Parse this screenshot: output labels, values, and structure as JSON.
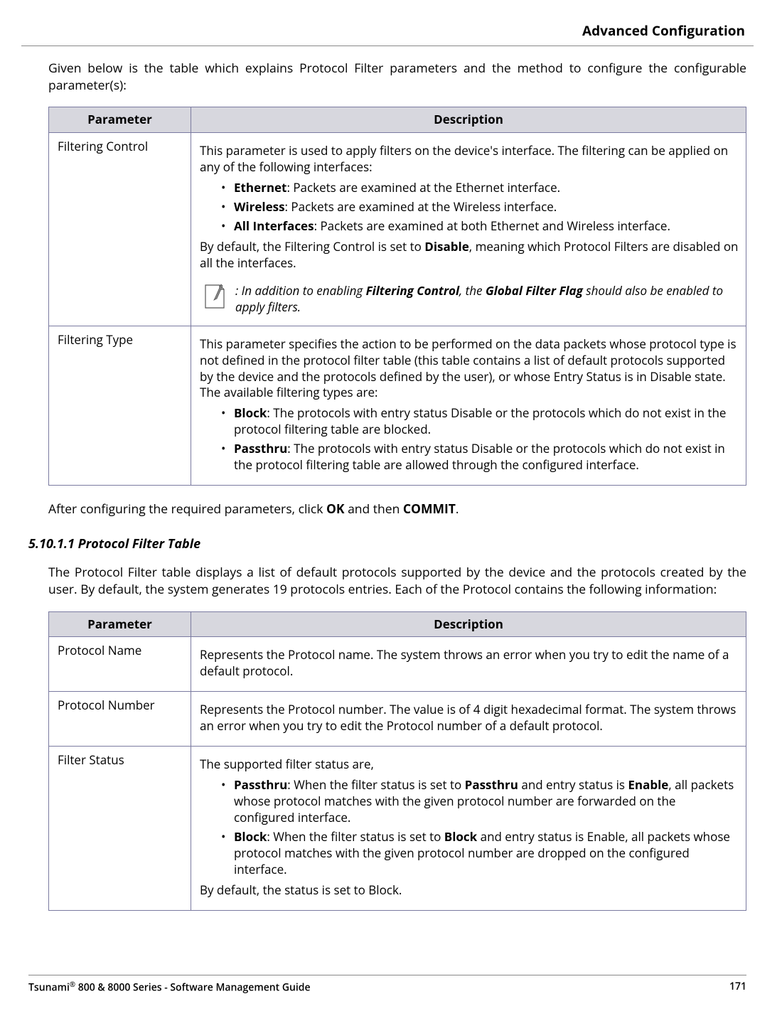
{
  "header": {
    "title": "Advanced Configuration"
  },
  "intro": "Given below is the table which explains Protocol Filter parameters and the method to configure the configurable parameter(s):",
  "table1": {
    "col1": "Parameter",
    "col2": "Description",
    "r1": {
      "param": "Filtering Control",
      "p1": "This parameter is used to apply filters on the device's interface. The filtering can be applied on any of the following interfaces:",
      "b1a": "Ethernet",
      "b1b": ": Packets are examined at the Ethernet interface.",
      "b2a": "Wireless",
      "b2b": ": Packets are examined at the Wireless interface.",
      "b3a": "All Interfaces",
      "b3b": ": Packets are examined at both Ethernet and Wireless interface.",
      "p2a": "By default, the Filtering Control is set to ",
      "p2b": "Disable",
      "p2c": ", meaning which Protocol Filters are disabled on all the interfaces.",
      "noteA": ": In addition to enabling ",
      "noteB": "Filtering Control",
      "noteC": ", the ",
      "noteD": "Global Filter Flag",
      "noteE": " should also be enabled to apply filters."
    },
    "r2": {
      "param": "Filtering Type",
      "p1": "This parameter specifies the action to be performed on the data packets whose protocol type is not defined in the protocol filter table (this table contains a list of default protocols supported by the device and the protocols defined by the user), or whose Entry Status is in Disable state. The available filtering types are:",
      "b1a": "Block",
      "b1b": ": The protocols with entry status Disable or the protocols which do not exist in the protocol filtering table are blocked.",
      "b2a": "Passthru",
      "b2b": ": The protocols with entry status Disable or the protocols which do not exist in the protocol filtering table are allowed through the configured interface."
    }
  },
  "mid": {
    "p1a": "After configuring the required parameters, click ",
    "p1b": "OK",
    "p1c": " and then ",
    "p1d": "COMMIT",
    "p1e": "."
  },
  "subhead": "5.10.1.1 Protocol Filter Table",
  "subintro": "The Protocol Filter table displays a list of default protocols supported by the device and the protocols created by the user. By default, the system generates 19 protocols entries. Each of the Protocol contains the following information:",
  "table2": {
    "col1": "Parameter",
    "col2": "Description",
    "r1": {
      "param": "Protocol Name",
      "desc": "Represents the Protocol name. The system throws an error when you try to edit the name of a default protocol."
    },
    "r2": {
      "param": "Protocol Number",
      "desc": "Represents the Protocol number. The value is of 4 digit hexadecimal format. The system throws an error when you try to edit the Protocol number of a default protocol."
    },
    "r3": {
      "param": "Filter Status",
      "p1": "The supported filter status are,",
      "b1a": "Passthru",
      "b1b": ": When the filter status is set to ",
      "b1c": "Passthru",
      "b1d": " and entry status is ",
      "b1e": "Enable",
      "b1f": ", all packets whose protocol matches with the given protocol number are forwarded on the configured interface.",
      "b2a": "Block",
      "b2b": ": When the filter status is set to ",
      "b2c": "Block",
      "b2d": " and entry status is Enable, all packets whose protocol matches with the given protocol number are dropped on the configured interface.",
      "p2": "By default, the status is set to Block."
    }
  },
  "footer": {
    "leftA": "Tsunami",
    "leftB": " 800 & 8000 Series - Software Management Guide",
    "pageno": "171"
  }
}
